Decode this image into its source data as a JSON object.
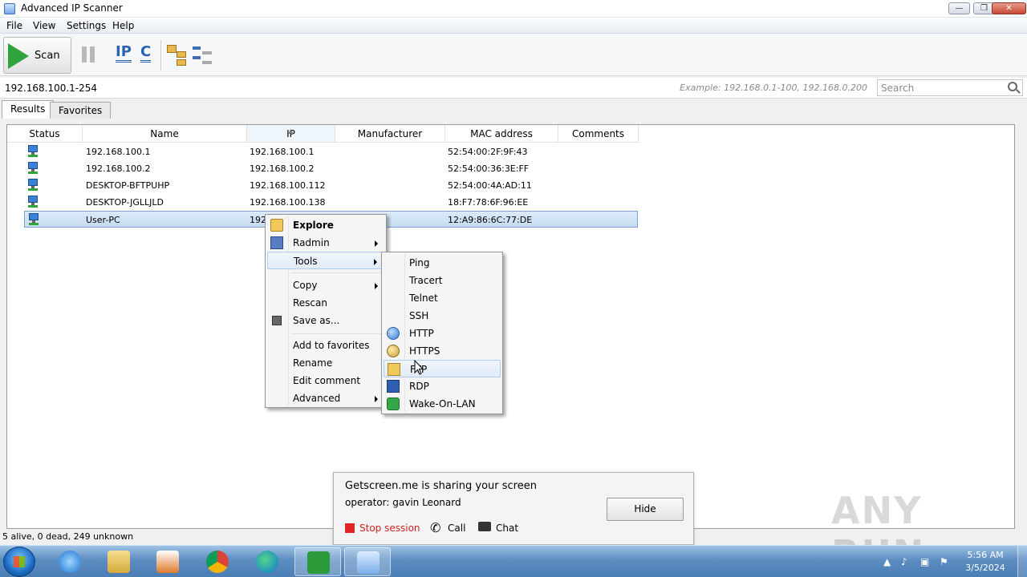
{
  "window": {
    "title": "Advanced IP Scanner"
  },
  "menu": [
    "File",
    "View",
    "Settings",
    "Help"
  ],
  "toolbar": {
    "scan_label": "Scan",
    "ip_label": "IP",
    "c_label": "C"
  },
  "address": {
    "range": "192.168.100.1-254",
    "example": "Example: 192.168.0.1-100, 192.168.0.200",
    "search_placeholder": "Search"
  },
  "tabs": [
    "Results",
    "Favorites"
  ],
  "columns": [
    "Status",
    "Name",
    "IP",
    "Manufacturer",
    "MAC address",
    "Comments"
  ],
  "rows": [
    {
      "name": "192.168.100.1",
      "ip": "192.168.100.1",
      "manufacturer": "",
      "mac": "52:54:00:2F:9F:43"
    },
    {
      "name": "192.168.100.2",
      "ip": "192.168.100.2",
      "manufacturer": "",
      "mac": "52:54:00:36:3E:FF"
    },
    {
      "name": "DESKTOP-BFTPUHP",
      "ip": "192.168.100.112",
      "manufacturer": "",
      "mac": "52:54:00:4A:AD:11"
    },
    {
      "name": "DESKTOP-JGLLJLD",
      "ip": "192.168.100.138",
      "manufacturer": "",
      "mac": "18:F7:78:6F:96:EE"
    },
    {
      "name": "User-PC",
      "ip": "192",
      "manufacturer": "",
      "mac": "12:A9:86:6C:77:DE"
    }
  ],
  "context_menu": {
    "explore": "Explore",
    "radmin": "Radmin",
    "tools": "Tools",
    "copy": "Copy",
    "rescan": "Rescan",
    "save_as": "Save as...",
    "add_favorites": "Add to favorites",
    "rename": "Rename",
    "edit_comment": "Edit comment",
    "advanced": "Advanced"
  },
  "tools_menu": [
    "Ping",
    "Tracert",
    "Telnet",
    "SSH",
    "HTTP",
    "HTTPS",
    "FTP",
    "RDP",
    "Wake-On-LAN"
  ],
  "status_text": "5 alive, 0 dead, 249 unknown",
  "share_popup": {
    "title": "Getscreen.me is sharing your screen",
    "operator": "operator: gavin Leonard",
    "hide": "Hide",
    "stop": "Stop session",
    "call": "Call",
    "chat": "Chat"
  },
  "watermark": "ANY RUN",
  "clock": {
    "time": "5:56 AM",
    "date": "3/5/2024"
  },
  "colors": {
    "accent": "#2a62b3",
    "scan_green": "#2fa33c",
    "stop_red": "#e12424",
    "selection": "#c7ddf3"
  }
}
